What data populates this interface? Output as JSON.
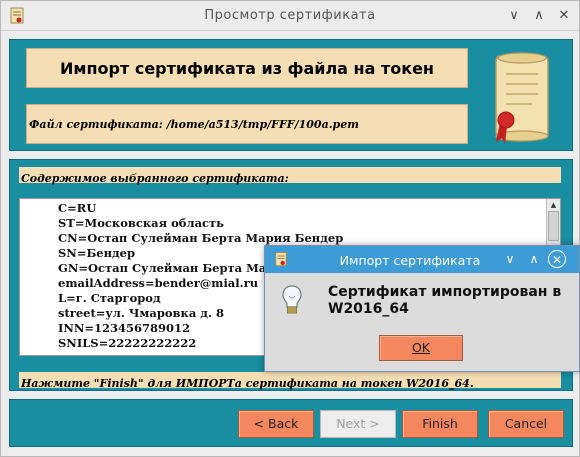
{
  "window": {
    "title": "Просмотр сертификата",
    "controls": {
      "minimize": "∨",
      "maximize": "∧",
      "close": "✕"
    }
  },
  "header": {
    "heading": "Импорт сертификата из файла на токен",
    "file_label": "Файл сертификата: /home/a513/tmp/FFF/100a.pem"
  },
  "contents": {
    "label": "Содержимое выбранного сертификата:",
    "lines": [
      "C=RU",
      "ST=Московская область",
      "CN=Остап Сулейман Берта Мария Бендер",
      "SN=Бендер",
      "GN=Остап Сулейман Берта Мария",
      "emailAddress=bender@mial.ru",
      "L=г. Старгород",
      "street=ул. Чмаровка д. 8",
      "INN=123456789012",
      "SNILS=22222222222"
    ],
    "scroll_up": "▲",
    "hint": "Нажмите \"Finish\" для ИМПОРТа сертификата на токен W2016_64."
  },
  "buttons": {
    "back": "< Back",
    "next": "Next >",
    "finish": "Finish",
    "cancel": "Cancel"
  },
  "dialog": {
    "title": "Импорт сертификата",
    "controls": {
      "minimize": "∨",
      "maximize": "∧",
      "close": "✕"
    },
    "message": "Сертификат импортирован в W2016_64",
    "ok": "OK"
  },
  "colors": {
    "teal_panel": "#188ea0",
    "wheat_box": "#f5deb3",
    "button": "#f4875e",
    "dialog_title": "#3d9bd6"
  }
}
